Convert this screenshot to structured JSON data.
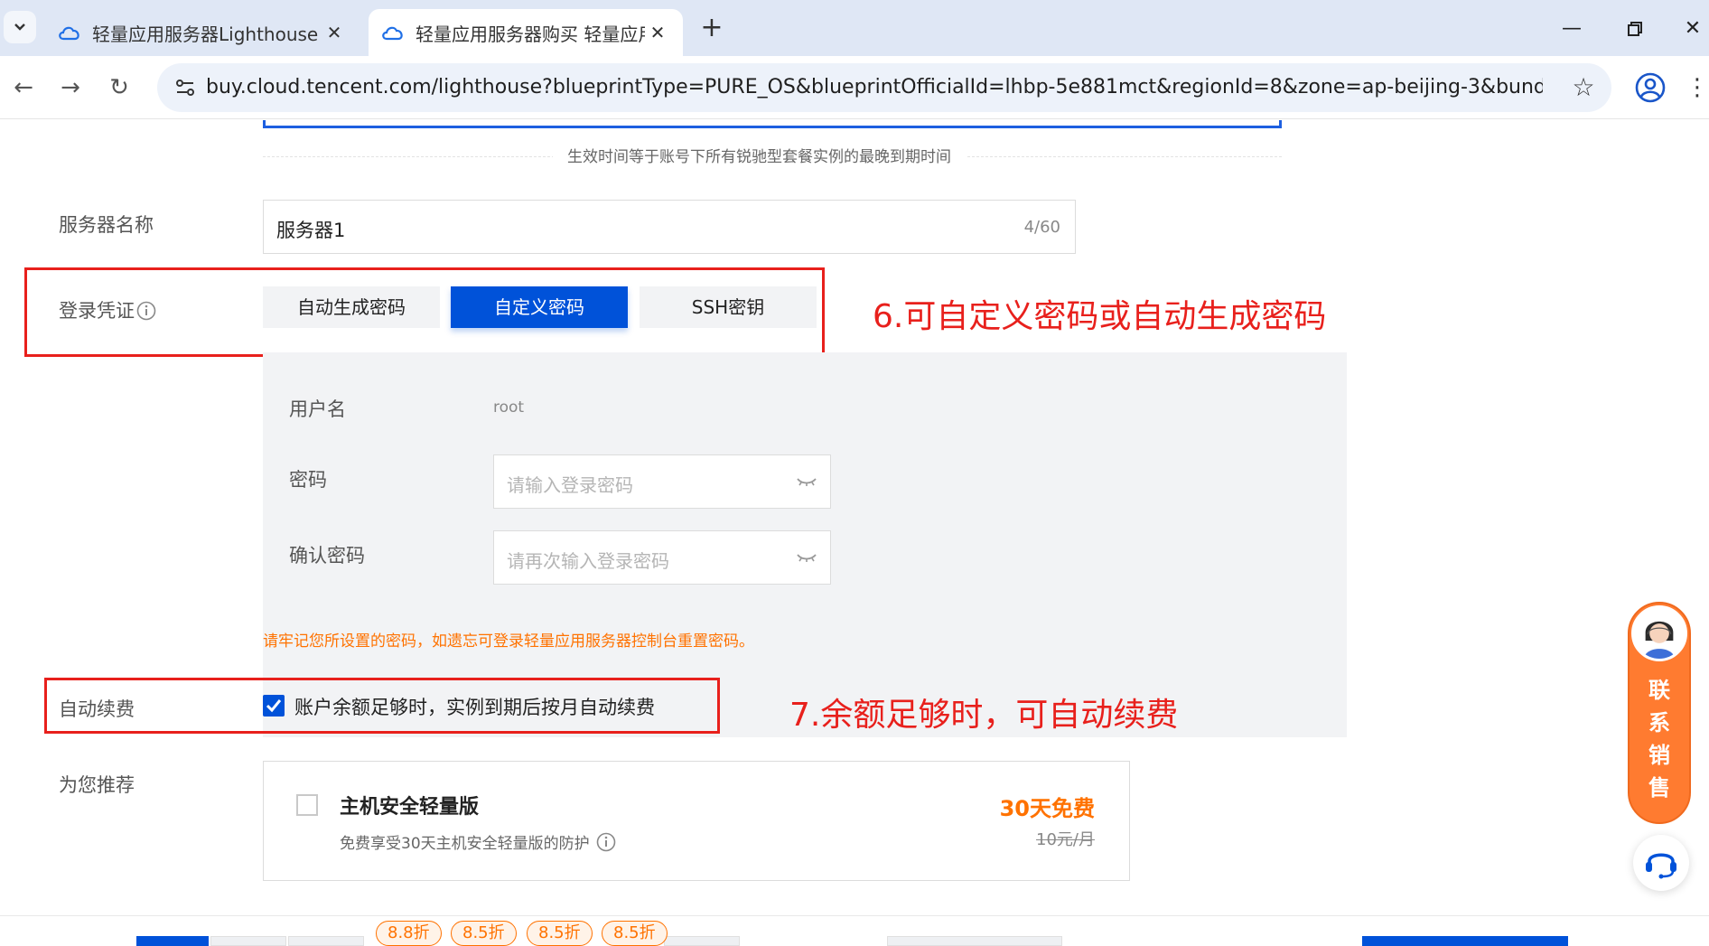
{
  "browser": {
    "tabs": [
      {
        "title": "轻量应用服务器Lighthouse 香",
        "icon": "cloud-icon"
      },
      {
        "title": "轻量应用服务器购买 轻量应用!",
        "icon": "cloud-icon"
      }
    ],
    "url": "buy.cloud.tencent.com/lighthouse?blueprintType=PURE_OS&blueprintOfficialId=lhbp-5e881mct&regionId=8&zone=ap-beijing-3&bundleId=bun..."
  },
  "notice": "生效时间等于账号下所有锐驰型套餐实例的最晚到期时间",
  "server_name": {
    "label": "服务器名称",
    "value": "服务器1",
    "count": "4/60"
  },
  "login": {
    "label": "登录凭证",
    "options": [
      "自动生成密码",
      "自定义密码",
      "SSH密钥"
    ],
    "selected": "自定义密码",
    "username_label": "用户名",
    "username_value": "root",
    "password_label": "密码",
    "password_placeholder": "请输入登录密码",
    "confirm_label": "确认密码",
    "confirm_placeholder": "请再次输入登录密码",
    "warning": "请牢记您所设置的密码，如遗忘可登录轻量应用服务器控制台重置密码。"
  },
  "auto_renew": {
    "label": "自动续费",
    "checked": true,
    "text": "账户余额足够时，实例到期后按月自动续费"
  },
  "recommend": {
    "label": "为您推荐",
    "title": "主机安全轻量版",
    "desc": "免费享受30天主机安全轻量版的防护",
    "free": "30天免费",
    "price": "10元/月"
  },
  "discounts": [
    "8.8折",
    "8.5折",
    "8.5折",
    "8.5折"
  ],
  "annotations": {
    "step6": "6.可自定义密码或自动生成密码",
    "step7": "7.余额足够时，可自动续费"
  },
  "sales_widget": {
    "text": [
      "联",
      "系",
      "销",
      "售"
    ]
  },
  "colors": {
    "primary": "#0052d9",
    "warning": "#ff7200",
    "annotation": "#e8201c"
  }
}
